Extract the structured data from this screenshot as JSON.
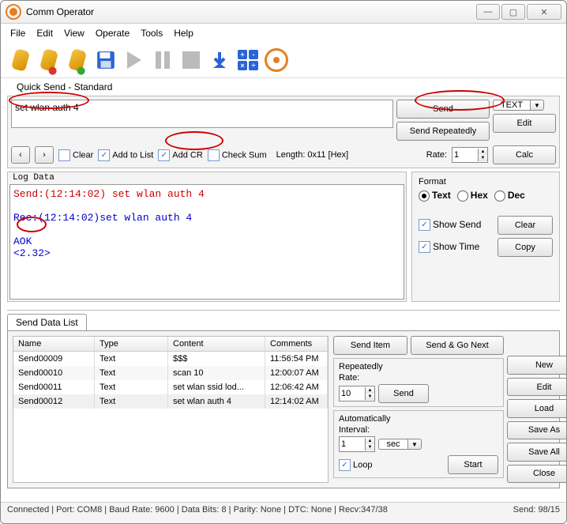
{
  "title": "Comm Operator",
  "menu": [
    "File",
    "Edit",
    "View",
    "Operate",
    "Tools",
    "Help"
  ],
  "quickSend": {
    "label": "Quick Send - Standard",
    "input": "set wlan auth 4",
    "send": "Send",
    "sendRepeatedly": "Send Repeatedly",
    "textMode": "TEXT",
    "edit": "Edit",
    "calc": "Calc",
    "clear": "Clear",
    "addToList": "Add to List",
    "addCR": "Add CR",
    "checkSum": "Check Sum",
    "length": "Length: 0x11 [Hex]",
    "rateLabel": "Rate:",
    "rateValue": "1"
  },
  "logData": {
    "title": "Log Data",
    "l1": "Send:(12:14:02) set wlan auth 4",
    "l2": "Rec:(12:14:02)set wlan auth 4",
    "l3": "AOK",
    "l4": "<2.32>"
  },
  "format": {
    "title": "Format",
    "text": "Text",
    "hex": "Hex",
    "dec": "Dec",
    "showSend": "Show Send",
    "showTime": "Show Time",
    "clear": "Clear",
    "copy": "Copy"
  },
  "sendList": {
    "tab": "Send Data List",
    "headers": {
      "name": "Name",
      "type": "Type",
      "content": "Content",
      "comments": "Comments"
    },
    "rows": [
      {
        "name": "Send00009",
        "type": "Text",
        "content": "$$$",
        "comments": "11:56:54 PM"
      },
      {
        "name": "Send00010",
        "type": "Text",
        "content": "scan 10",
        "comments": "12:00:07 AM"
      },
      {
        "name": "Send00011",
        "type": "Text",
        "content": "set wlan ssid lod...",
        "comments": "12:06:42 AM"
      },
      {
        "name": "Send00012",
        "type": "Text",
        "content": "set wlan auth 4",
        "comments": "12:14:02 AM"
      }
    ],
    "sendItem": "Send Item",
    "sendGoNext": "Send & Go Next",
    "repeatedly": "Repeatedly",
    "rateLabel": "Rate:",
    "rateValue": "10",
    "sendBtn": "Send",
    "automatically": "Automatically",
    "interval": "Interval:",
    "intervalValue": "1",
    "unit": "sec",
    "loop": "Loop",
    "start": "Start",
    "new": "New",
    "edit": "Edit",
    "load": "Load",
    "saveAs": "Save As",
    "saveAll": "Save All",
    "close": "Close"
  },
  "status": {
    "left": "Connected | Port: COM8 | Baud Rate: 9600 | Data Bits: 8 | Parity: None | DTC: None | Recv:347/38",
    "right": "Send: 98/15"
  }
}
